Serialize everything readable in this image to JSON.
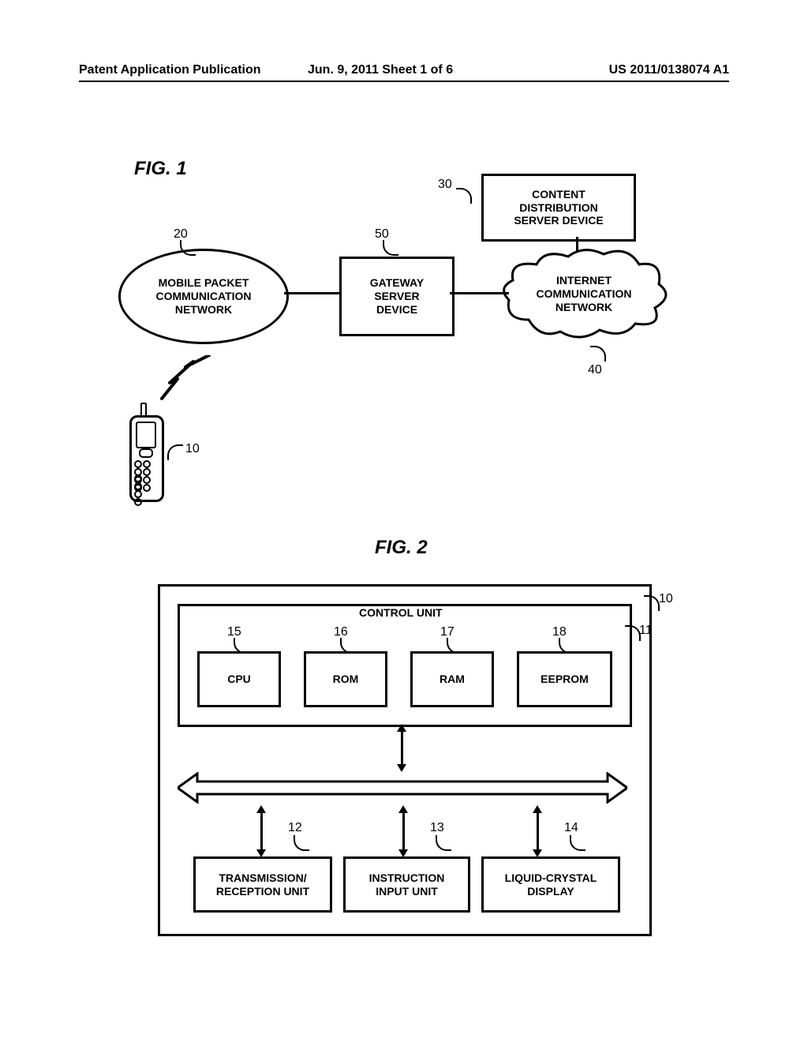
{
  "header": {
    "left": "Patent Application Publication",
    "center": "Jun. 9, 2011  Sheet 1 of 6",
    "right": "US 2011/0138074 A1"
  },
  "fig1": {
    "label": "FIG. 1",
    "mobile_network": "MOBILE PACKET\nCOMMUNICATION\nNETWORK",
    "gateway": "GATEWAY\nSERVER\nDEVICE",
    "content_server": "CONTENT\nDISTRIBUTION\nSERVER DEVICE",
    "internet": "INTERNET\nCOMMUNICATION\nNETWORK",
    "ref_phone": "10",
    "ref_mobile_network": "20",
    "ref_content_server": "30",
    "ref_internet": "40",
    "ref_gateway": "50"
  },
  "fig2": {
    "label": "FIG. 2",
    "control_unit": "CONTROL UNIT",
    "cpu": "CPU",
    "rom": "ROM",
    "ram": "RAM",
    "eeprom": "EEPROM",
    "txrx": "TRANSMISSION/\nRECEPTION UNIT",
    "input": "INSTRUCTION\nINPUT UNIT",
    "lcd": "LIQUID-CRYSTAL\nDISPLAY",
    "ref_outer": "10",
    "ref_control": "11",
    "ref_txrx": "12",
    "ref_input": "13",
    "ref_lcd": "14",
    "ref_cpu": "15",
    "ref_rom": "16",
    "ref_ram": "17",
    "ref_eeprom": "18"
  }
}
